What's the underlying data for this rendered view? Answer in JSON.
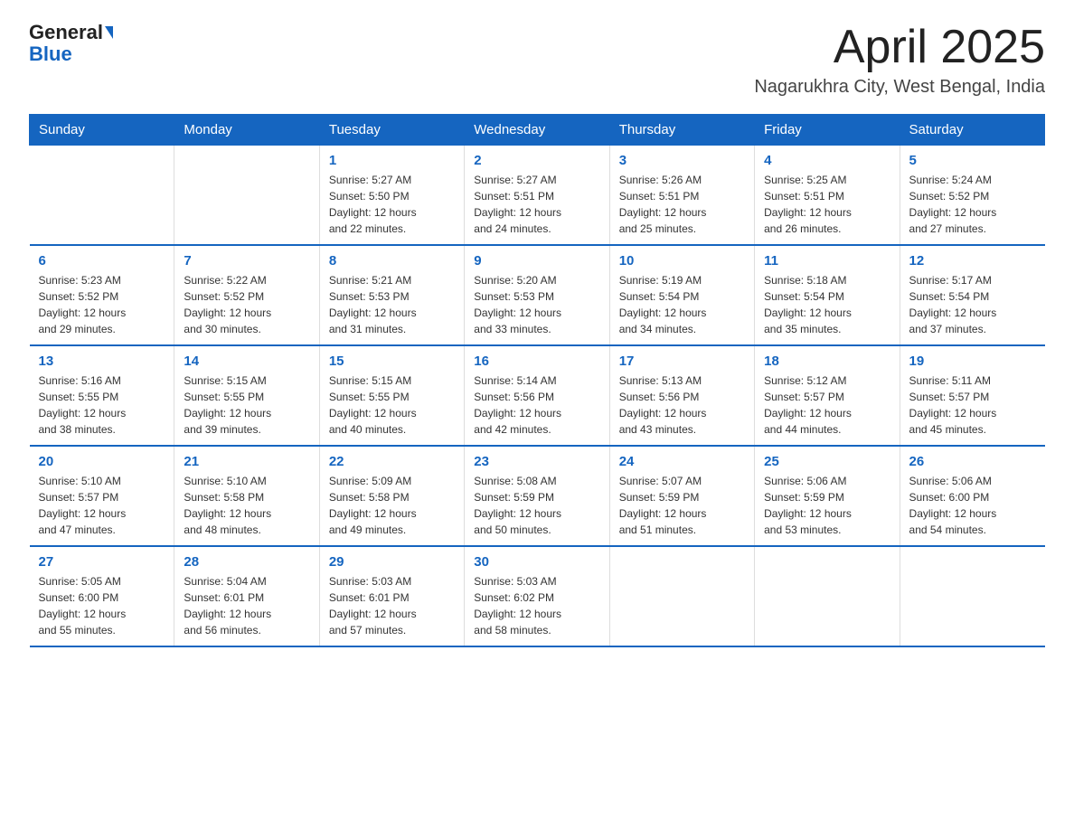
{
  "header": {
    "logo_general": "General",
    "logo_blue": "Blue",
    "month_title": "April 2025",
    "location": "Nagarukhra City, West Bengal, India"
  },
  "weekdays": [
    "Sunday",
    "Monday",
    "Tuesday",
    "Wednesday",
    "Thursday",
    "Friday",
    "Saturday"
  ],
  "weeks": [
    [
      {
        "day": "",
        "info": ""
      },
      {
        "day": "",
        "info": ""
      },
      {
        "day": "1",
        "info": "Sunrise: 5:27 AM\nSunset: 5:50 PM\nDaylight: 12 hours\nand 22 minutes."
      },
      {
        "day": "2",
        "info": "Sunrise: 5:27 AM\nSunset: 5:51 PM\nDaylight: 12 hours\nand 24 minutes."
      },
      {
        "day": "3",
        "info": "Sunrise: 5:26 AM\nSunset: 5:51 PM\nDaylight: 12 hours\nand 25 minutes."
      },
      {
        "day": "4",
        "info": "Sunrise: 5:25 AM\nSunset: 5:51 PM\nDaylight: 12 hours\nand 26 minutes."
      },
      {
        "day": "5",
        "info": "Sunrise: 5:24 AM\nSunset: 5:52 PM\nDaylight: 12 hours\nand 27 minutes."
      }
    ],
    [
      {
        "day": "6",
        "info": "Sunrise: 5:23 AM\nSunset: 5:52 PM\nDaylight: 12 hours\nand 29 minutes."
      },
      {
        "day": "7",
        "info": "Sunrise: 5:22 AM\nSunset: 5:52 PM\nDaylight: 12 hours\nand 30 minutes."
      },
      {
        "day": "8",
        "info": "Sunrise: 5:21 AM\nSunset: 5:53 PM\nDaylight: 12 hours\nand 31 minutes."
      },
      {
        "day": "9",
        "info": "Sunrise: 5:20 AM\nSunset: 5:53 PM\nDaylight: 12 hours\nand 33 minutes."
      },
      {
        "day": "10",
        "info": "Sunrise: 5:19 AM\nSunset: 5:54 PM\nDaylight: 12 hours\nand 34 minutes."
      },
      {
        "day": "11",
        "info": "Sunrise: 5:18 AM\nSunset: 5:54 PM\nDaylight: 12 hours\nand 35 minutes."
      },
      {
        "day": "12",
        "info": "Sunrise: 5:17 AM\nSunset: 5:54 PM\nDaylight: 12 hours\nand 37 minutes."
      }
    ],
    [
      {
        "day": "13",
        "info": "Sunrise: 5:16 AM\nSunset: 5:55 PM\nDaylight: 12 hours\nand 38 minutes."
      },
      {
        "day": "14",
        "info": "Sunrise: 5:15 AM\nSunset: 5:55 PM\nDaylight: 12 hours\nand 39 minutes."
      },
      {
        "day": "15",
        "info": "Sunrise: 5:15 AM\nSunset: 5:55 PM\nDaylight: 12 hours\nand 40 minutes."
      },
      {
        "day": "16",
        "info": "Sunrise: 5:14 AM\nSunset: 5:56 PM\nDaylight: 12 hours\nand 42 minutes."
      },
      {
        "day": "17",
        "info": "Sunrise: 5:13 AM\nSunset: 5:56 PM\nDaylight: 12 hours\nand 43 minutes."
      },
      {
        "day": "18",
        "info": "Sunrise: 5:12 AM\nSunset: 5:57 PM\nDaylight: 12 hours\nand 44 minutes."
      },
      {
        "day": "19",
        "info": "Sunrise: 5:11 AM\nSunset: 5:57 PM\nDaylight: 12 hours\nand 45 minutes."
      }
    ],
    [
      {
        "day": "20",
        "info": "Sunrise: 5:10 AM\nSunset: 5:57 PM\nDaylight: 12 hours\nand 47 minutes."
      },
      {
        "day": "21",
        "info": "Sunrise: 5:10 AM\nSunset: 5:58 PM\nDaylight: 12 hours\nand 48 minutes."
      },
      {
        "day": "22",
        "info": "Sunrise: 5:09 AM\nSunset: 5:58 PM\nDaylight: 12 hours\nand 49 minutes."
      },
      {
        "day": "23",
        "info": "Sunrise: 5:08 AM\nSunset: 5:59 PM\nDaylight: 12 hours\nand 50 minutes."
      },
      {
        "day": "24",
        "info": "Sunrise: 5:07 AM\nSunset: 5:59 PM\nDaylight: 12 hours\nand 51 minutes."
      },
      {
        "day": "25",
        "info": "Sunrise: 5:06 AM\nSunset: 5:59 PM\nDaylight: 12 hours\nand 53 minutes."
      },
      {
        "day": "26",
        "info": "Sunrise: 5:06 AM\nSunset: 6:00 PM\nDaylight: 12 hours\nand 54 minutes."
      }
    ],
    [
      {
        "day": "27",
        "info": "Sunrise: 5:05 AM\nSunset: 6:00 PM\nDaylight: 12 hours\nand 55 minutes."
      },
      {
        "day": "28",
        "info": "Sunrise: 5:04 AM\nSunset: 6:01 PM\nDaylight: 12 hours\nand 56 minutes."
      },
      {
        "day": "29",
        "info": "Sunrise: 5:03 AM\nSunset: 6:01 PM\nDaylight: 12 hours\nand 57 minutes."
      },
      {
        "day": "30",
        "info": "Sunrise: 5:03 AM\nSunset: 6:02 PM\nDaylight: 12 hours\nand 58 minutes."
      },
      {
        "day": "",
        "info": ""
      },
      {
        "day": "",
        "info": ""
      },
      {
        "day": "",
        "info": ""
      }
    ]
  ]
}
